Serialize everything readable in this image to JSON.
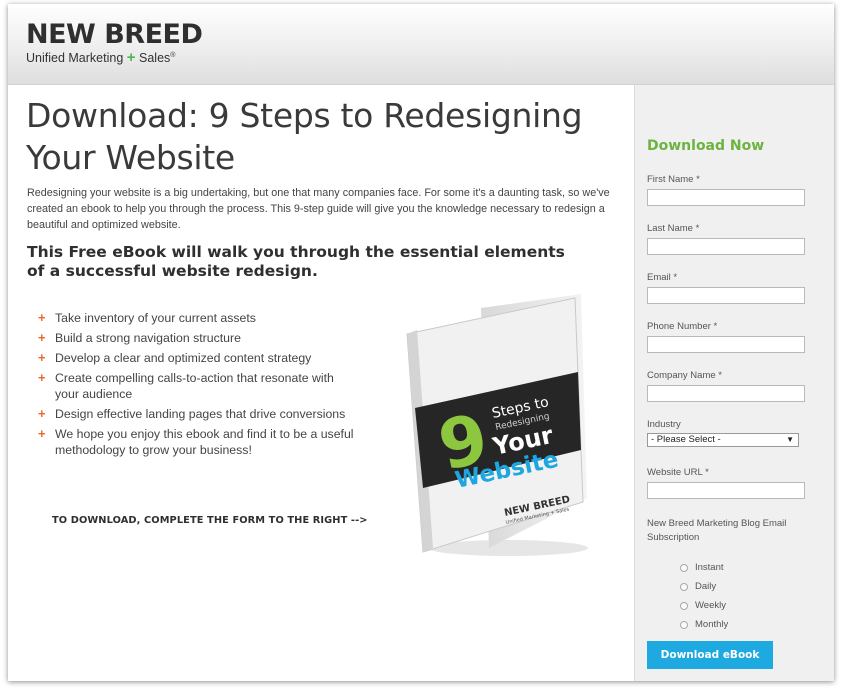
{
  "header": {
    "logo_main": "NEW BREED",
    "logo_sub_before": "Unified Marketing",
    "logo_sub_plus": "+",
    "logo_sub_after": "Sales",
    "logo_sub_mark": "®"
  },
  "main": {
    "title": "Download: 9 Steps to Redesigning Your Website",
    "intro": "Redesigning your website is a big undertaking, but one that many companies face. For some it's a daunting task, so we've created an ebook to help you through the process. This 9-step guide will give you the knowledge necessary to redesign a beautiful and optimized website.",
    "subhead": "This Free eBook will walk you through the essential elements of a successful website redesign.",
    "bullet_mark": "+",
    "bullets": [
      "Take inventory of your current assets",
      "Build a strong navigation structure",
      "Develop a clear and optimized content strategy",
      "Create compelling calls-to-action that resonate with your audience",
      "Design effective landing pages that drive conversions",
      "We hope you enjoy this ebook and find it to be a useful methodology to grow your business!"
    ],
    "cta": "TO DOWNLOAD, COMPLETE THE FORM TO THE RIGHT -->",
    "book": {
      "number": "9",
      "steps": "Steps to",
      "redesigning": "Redesigning",
      "your": "Your",
      "website": "Website",
      "brand": "NEW BREED",
      "brand_sub": "Unified Marketing + Sales"
    }
  },
  "form": {
    "title": "Download Now",
    "first_name": "First Name *",
    "last_name": "Last Name *",
    "email": "Email *",
    "phone": "Phone Number *",
    "company": "Company Name *",
    "industry": "Industry",
    "industry_selected": "- Please Select -",
    "industry_arrow": "▼",
    "website": "Website URL *",
    "subscription": "New Breed Marketing Blog Email Subscription",
    "options": [
      "Instant",
      "Daily",
      "Weekly",
      "Monthly"
    ],
    "submit": "Download eBook"
  },
  "colors": {
    "accent_green": "#6cb33f",
    "bullet_orange": "#e8692c",
    "button_blue": "#1fa9e1",
    "book_blue": "#1ea6e0",
    "book_green": "#8dc63f"
  }
}
